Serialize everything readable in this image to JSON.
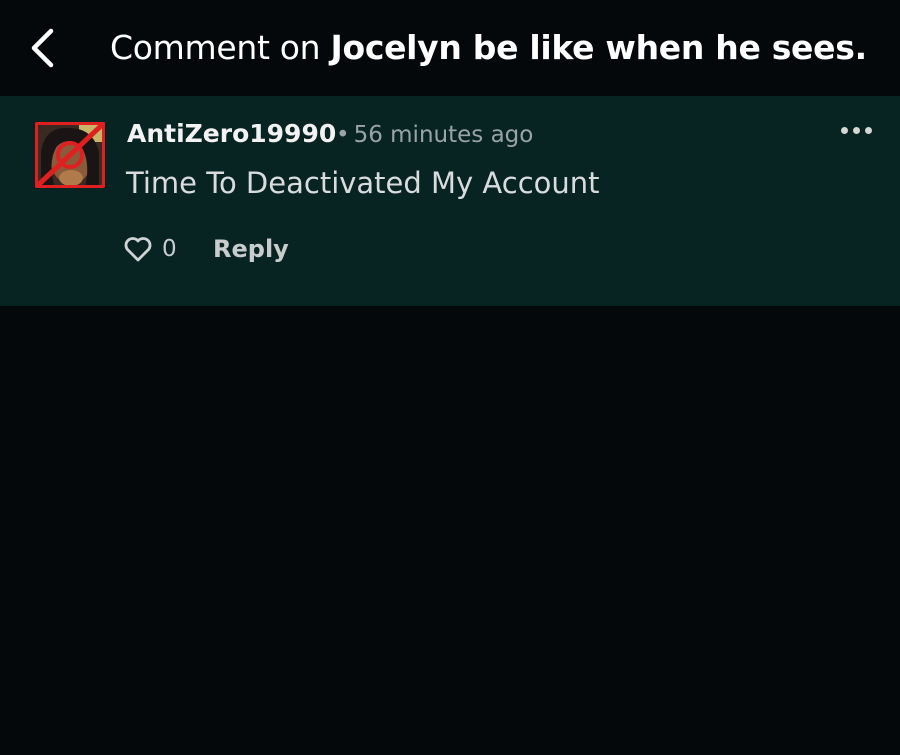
{
  "header": {
    "title_prefix": "Comment on ",
    "title_post": "Jocelyn be like when he sees...",
    "back_icon": "chevron-left-icon"
  },
  "comment": {
    "username": "AntiZero19990",
    "dot": "•",
    "timestamp": "56 minutes ago",
    "text": "Time To Deactivated My Account",
    "like_count": "0",
    "reply_label": "Reply",
    "more_icon": "more-horizontal-icon",
    "like_icon": "heart-outline-icon"
  },
  "colors": {
    "background": "#05080b",
    "comment_highlight": "#072423",
    "muted_text": "#9aa3a6"
  }
}
